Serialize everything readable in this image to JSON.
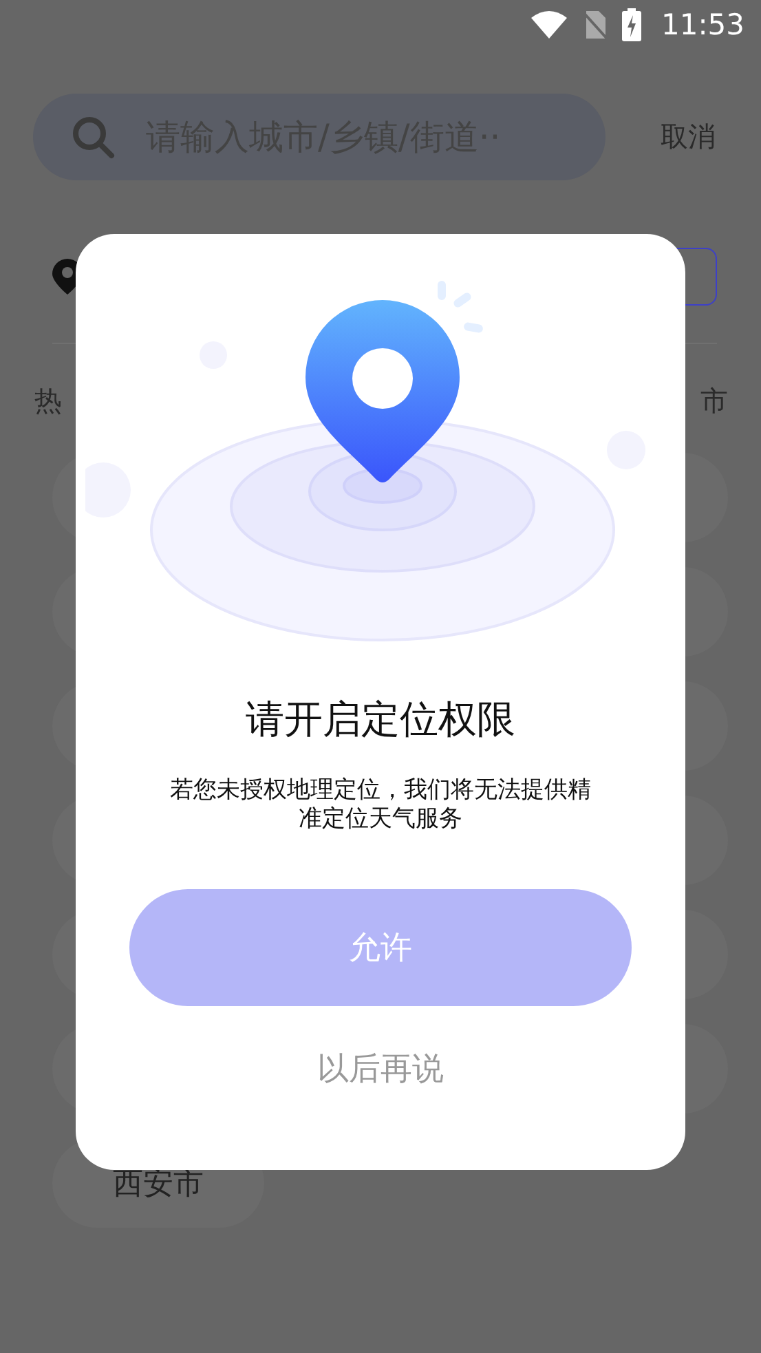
{
  "status_bar": {
    "time": "11:53"
  },
  "search": {
    "placeholder": "请输入城市/乡镇/街道··",
    "cancel": "取消"
  },
  "hot_heading": "热",
  "right_heading": "市",
  "cities": [
    {
      "name": "西安市"
    }
  ],
  "dialog": {
    "title": "请开启定位权限",
    "message": "若您未授权地理定位，我们将无法提供精准定位天气服务",
    "allow": "允许",
    "later": "以后再说"
  }
}
